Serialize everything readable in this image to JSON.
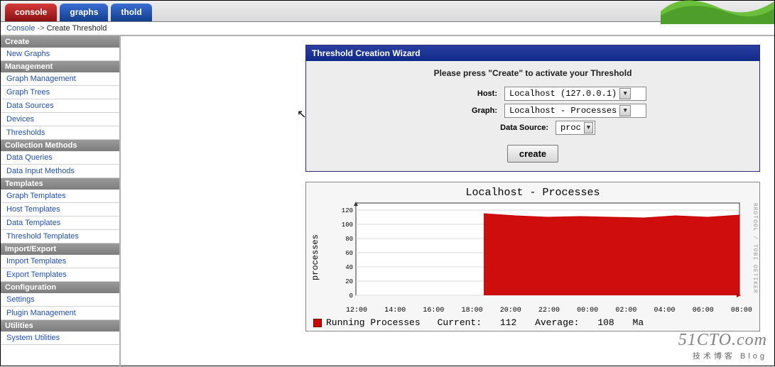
{
  "tabs": [
    {
      "label": "console",
      "style": "red"
    },
    {
      "label": "graphs",
      "style": "blue"
    },
    {
      "label": "thold",
      "style": "blue"
    }
  ],
  "breadcrumb": {
    "root": "Console",
    "sep": "->",
    "current": "Create Threshold"
  },
  "sidebar": [
    {
      "type": "head",
      "label": "Create"
    },
    {
      "type": "item",
      "label": "New Graphs"
    },
    {
      "type": "head",
      "label": "Management"
    },
    {
      "type": "item",
      "label": "Graph Management"
    },
    {
      "type": "item",
      "label": "Graph Trees"
    },
    {
      "type": "item",
      "label": "Data Sources"
    },
    {
      "type": "item",
      "label": "Devices"
    },
    {
      "type": "item",
      "label": "Thresholds"
    },
    {
      "type": "head",
      "label": "Collection Methods"
    },
    {
      "type": "item",
      "label": "Data Queries"
    },
    {
      "type": "item",
      "label": "Data Input Methods"
    },
    {
      "type": "head",
      "label": "Templates"
    },
    {
      "type": "item",
      "label": "Graph Templates"
    },
    {
      "type": "item",
      "label": "Host Templates"
    },
    {
      "type": "item",
      "label": "Data Templates"
    },
    {
      "type": "item",
      "label": "Threshold Templates"
    },
    {
      "type": "head",
      "label": "Import/Export"
    },
    {
      "type": "item",
      "label": "Import Templates"
    },
    {
      "type": "item",
      "label": "Export Templates"
    },
    {
      "type": "head",
      "label": "Configuration"
    },
    {
      "type": "item",
      "label": "Settings"
    },
    {
      "type": "item",
      "label": "Plugin Management"
    },
    {
      "type": "head",
      "label": "Utilities"
    },
    {
      "type": "item",
      "label": "System Utilities"
    }
  ],
  "wizard": {
    "title": "Threshold Creation Wizard",
    "prompt": "Please press \"Create\" to activate your Threshold",
    "fields": {
      "host_label": "Host:",
      "graph_label": "Graph:",
      "ds_label": "Data Source:"
    },
    "host_value": "Localhost (127.0.0.1)",
    "graph_value": "Localhost - Processes",
    "ds_value": "proc",
    "create_label": "create"
  },
  "chart_data": {
    "type": "line",
    "title": "Localhost - Processes",
    "ylabel": "processes",
    "ylim": [
      0,
      130
    ],
    "yticks": [
      0,
      20,
      40,
      60,
      80,
      100,
      120
    ],
    "xticks": [
      "12:00",
      "14:00",
      "16:00",
      "18:00",
      "20:00",
      "22:00",
      "00:00",
      "02:00",
      "04:00",
      "06:00",
      "08:00"
    ],
    "series": [
      {
        "name": "Running Processes",
        "color": "#cc0000",
        "x": [
          "12:00",
          "14:00",
          "16:00",
          "18:00",
          "18:30",
          "20:00",
          "22:00",
          "00:00",
          "02:00",
          "04:00",
          "06:00",
          "08:00",
          "10:00"
        ],
        "values": [
          null,
          null,
          null,
          null,
          115,
          112,
          110,
          111,
          110,
          109,
          112,
          110,
          113
        ]
      }
    ],
    "legend_stats": {
      "current_label": "Current:",
      "current": 112,
      "average_label": "Average:",
      "average": 108,
      "max_label": "Ma"
    },
    "rrd_credit": "RRDTOOL / TOBI OETIKER"
  },
  "watermark": {
    "main": "51CTO.com",
    "sub": "技术博客   Blog"
  }
}
